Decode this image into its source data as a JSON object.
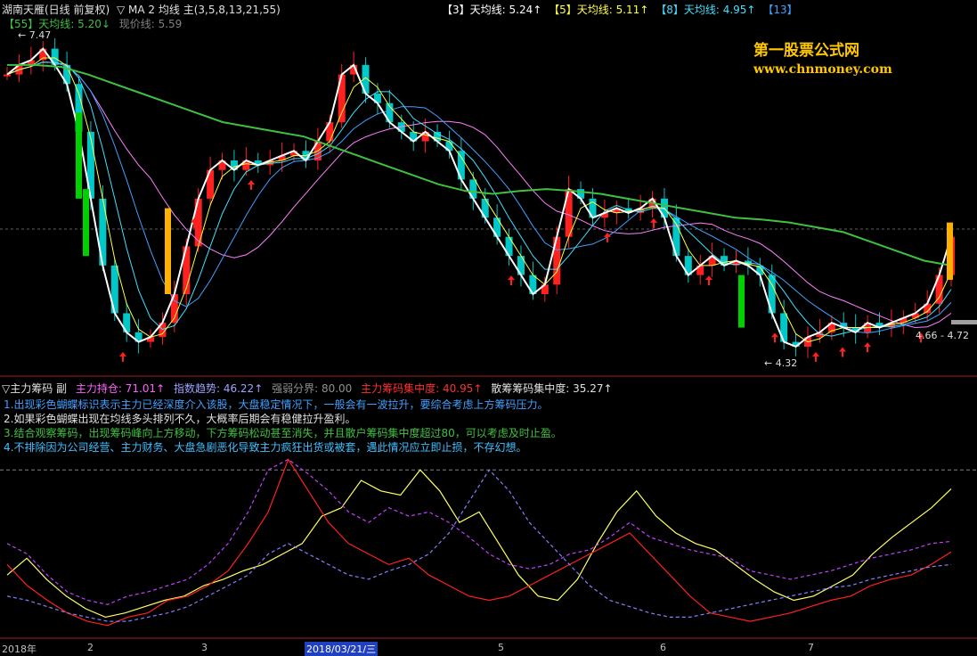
{
  "colors": {
    "up": "#ff2020",
    "down": "#00c8c8",
    "ma3": "#ffffff",
    "ma5": "#ffff40",
    "ma8": "#40e0ff",
    "ma13": "#40a0ff",
    "ma21": "#ff80ff",
    "ma55": "#ff9060",
    "long": "#40c040",
    "green_bar": "#00d000",
    "gold_bar": "#ffb000",
    "holding": "#ffff66",
    "trend": "#c040ff",
    "trend2": "#8080ff",
    "chip": "#ff2020"
  },
  "header": {
    "title": "湖南天雁(日线 前复权)",
    "ma_label": "▽ MA 2 均线 主(3,5,8,13,21,55)",
    "ma3": "【3】天均线: 5.24↑",
    "ma5": "【5】天均线: 5.11↑",
    "ma8": "【8】天均线: 4.95↑",
    "ma13": "【13】",
    "ma55": "【55】天均线: 5.20↓",
    "price": "现价线: 5.59"
  },
  "watermark": {
    "line1": "第一股票公式网",
    "line2": "www.chnmoney.com"
  },
  "price_labels": {
    "high": "7.47",
    "low": "4.32",
    "range": "4.66 - 4.72"
  },
  "sub_header": {
    "title": "▽主力筹码 副",
    "holding": "主力持仓: 71.01↑",
    "trend": "指数趋势: 46.22↑",
    "strength": "强弱分界: 80.00",
    "main_chip": "主力筹码集中度: 40.95↑",
    "retail_chip": "散筹筹码集中度: 35.27↑"
  },
  "notes": [
    "1.出现彩色蝴蝶标识表示主力已经深度介入该股，大盘稳定情况下，一般会有一波拉升，要综合考虑上方筹码压力。",
    "2.如果彩色蝴蝶出现在均线多头排列不久，大概率后期会有稳健拉升盈利。",
    "3.结合观察筹码，出现筹码峰向上方移动，下方筹码松动甚至消失，并且散户筹码集中度超过80，可以考虑及时止盈。",
    "4.不排除因为公司经营、主力财务、大盘急剧恶化导致主力疯狂出货或被套，遇此情况应立即止损，不存幻想。"
  ],
  "x_axis": {
    "year": "2018年",
    "m2": "2",
    "m3": "3",
    "date": "2018/03/21/三",
    "m5": "5",
    "m6": "6",
    "m7": "7"
  },
  "chart_data": {
    "type": "candlestick",
    "close_path": [
      7.2,
      7.3,
      7.35,
      7.47,
      7.3,
      7.1,
      6.6,
      5.9,
      5.2,
      4.7,
      4.5,
      4.4,
      4.45,
      4.6,
      4.9,
      5.4,
      5.9,
      6.2,
      6.3,
      6.2,
      6.3,
      6.25,
      6.3,
      6.35,
      6.4,
      6.3,
      6.5,
      6.7,
      7.2,
      7.3,
      7.0,
      6.9,
      6.7,
      6.6,
      6.5,
      6.6,
      6.5,
      6.4,
      6.1,
      5.9,
      5.7,
      5.5,
      5.3,
      5.1,
      4.9,
      5.0,
      5.5,
      6.0,
      5.9,
      5.7,
      5.75,
      5.8,
      5.75,
      5.8,
      5.9,
      5.7,
      5.3,
      5.1,
      5.2,
      5.3,
      5.2,
      5.25,
      5.2,
      5.1,
      4.7,
      4.4,
      4.35,
      4.45,
      4.5,
      4.6,
      4.55,
      4.5,
      4.6,
      4.55,
      4.6,
      4.65,
      4.7,
      4.8,
      5.1,
      5.5
    ],
    "ma55_path": [
      7.3,
      7.3,
      7.28,
      7.2,
      7.1,
      7.0,
      6.9,
      6.8,
      6.7,
      6.65,
      6.6,
      6.55,
      6.45,
      6.35,
      6.25,
      6.15,
      6.05,
      5.98,
      5.95,
      5.98,
      6.0,
      5.98,
      5.95,
      5.9,
      5.85,
      5.8,
      5.75,
      5.7,
      5.68,
      5.65,
      5.6,
      5.55,
      5.45,
      5.35,
      5.25,
      5.2
    ],
    "sub_ylim": [
      0,
      100
    ],
    "strength_line": 80.0,
    "series": [
      {
        "name": "主力持仓",
        "values": [
          30,
          38,
          28,
          20,
          14,
          10,
          12,
          15,
          18,
          20,
          25,
          28,
          32,
          35,
          40,
          45,
          58,
          62,
          75,
          70,
          68,
          80,
          70,
          55,
          60,
          45,
          30,
          20,
          18,
          28,
          45,
          60,
          70,
          58,
          50,
          45,
          42,
          35,
          28,
          22,
          18,
          20,
          25,
          30,
          40,
          48,
          55,
          62,
          71
        ]
      },
      {
        "name": "指数趋势",
        "values": [
          45,
          40,
          30,
          22,
          18,
          16,
          20,
          22,
          25,
          28,
          35,
          45,
          60,
          80,
          85,
          78,
          70,
          60,
          55,
          62,
          58,
          60,
          55,
          48,
          40,
          35,
          33,
          35,
          40,
          42,
          48,
          55,
          48,
          45,
          42,
          40,
          38,
          32,
          30,
          28,
          30,
          32,
          35,
          38,
          40,
          42,
          45,
          46
        ]
      },
      {
        "name": "主力筹码集中度",
        "values": [
          35,
          25,
          18,
          12,
          8,
          6,
          10,
          12,
          18,
          20,
          25,
          32,
          45,
          60,
          85,
          70,
          55,
          45,
          40,
          35,
          38,
          30,
          25,
          20,
          18,
          20,
          25,
          30,
          35,
          40,
          45,
          50,
          40,
          30,
          20,
          12,
          10,
          8,
          10,
          12,
          15,
          18,
          20,
          25,
          28,
          30,
          35,
          41
        ]
      },
      {
        "name": "散筹筹码集中度",
        "values": [
          20,
          18,
          15,
          12,
          10,
          8,
          8,
          10,
          12,
          15,
          20,
          25,
          30,
          40,
          45,
          40,
          35,
          30,
          28,
          32,
          35,
          40,
          50,
          65,
          80,
          70,
          55,
          45,
          35,
          25,
          18,
          15,
          12,
          10,
          10,
          12,
          14,
          16,
          18,
          20,
          22,
          24,
          25,
          28,
          30,
          32,
          34,
          35
        ]
      }
    ]
  }
}
